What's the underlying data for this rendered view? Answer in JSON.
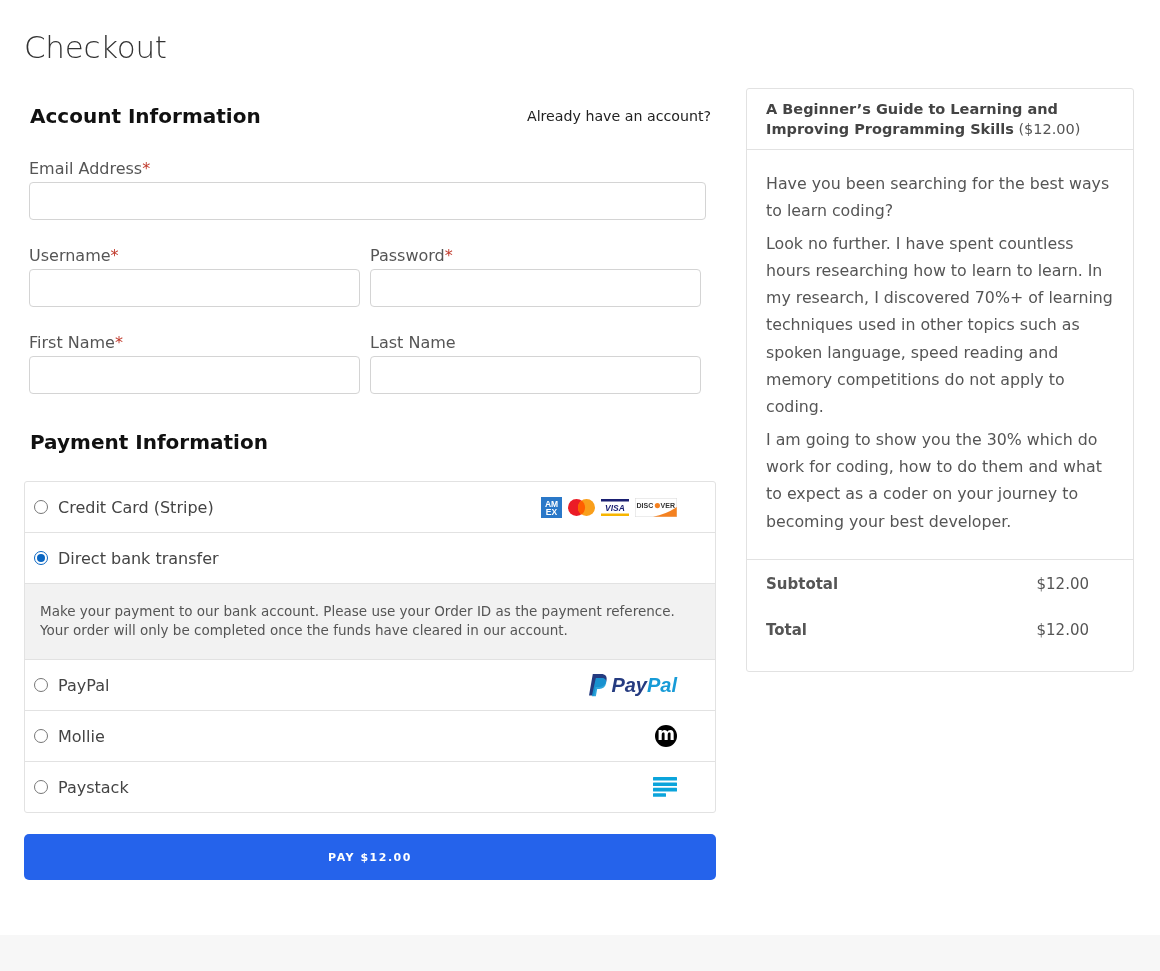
{
  "page": {
    "title": "Checkout"
  },
  "account": {
    "heading": "Account Information",
    "login_link": "Already have an account?",
    "required_mark": "*",
    "field_rows": [
      [
        {
          "label": "Email Address",
          "required": true
        }
      ],
      [
        {
          "label": "Username",
          "required": true
        },
        {
          "label": "Password",
          "required": true
        }
      ],
      [
        {
          "label": "First Name",
          "required": true
        },
        {
          "label": "Last Name",
          "required": false
        }
      ]
    ]
  },
  "payment": {
    "heading": "Payment Information",
    "methods": [
      {
        "label": "Credit Card (Stripe)",
        "selected": false,
        "logo": {
          "kind": "cards",
          "cards": [
            {
              "kind": "amex",
              "lines": [
                "AM",
                "EX"
              ]
            },
            {
              "kind": "mastercard"
            },
            {
              "kind": "visa",
              "text": "VISA"
            },
            {
              "kind": "discover",
              "parts": [
                "DISC",
                "VER"
              ]
            }
          ]
        }
      },
      {
        "label": "Direct bank transfer",
        "selected": true,
        "description": "Make your payment to our bank account. Please use your Order ID as the payment reference. Your order will only be completed once the funds have cleared in our account."
      },
      {
        "label": "PayPal",
        "selected": false,
        "logo": {
          "kind": "paypal",
          "parts": [
            "Pay",
            "Pal"
          ]
        }
      },
      {
        "label": "Mollie",
        "selected": false,
        "logo": {
          "kind": "mollie",
          "mark": "m"
        }
      },
      {
        "label": "Paystack",
        "selected": false,
        "logo": {
          "kind": "paystack"
        }
      }
    ]
  },
  "pay_button": "PAY $12.00",
  "summary": {
    "product_title": "**A Beginner’s Guide to Learning and Improving Programming Skills** ($12.00)",
    "paragraphs": [
      "Have you been searching for the best ways to learn coding?",
      "Look no further. I have spent countless hours researching how to learn to learn. In my research, I discovered 70%+ of learning techniques used in other topics such as spoken language, speed reading and memory competitions do not apply to coding.",
      "I am going to show you the 30% which do work for coding, how to do them and what to expect as a coder on your journey to becoming your best developer."
    ],
    "totals": [
      {
        "label": "Subtotal",
        "value": "$12.00"
      },
      {
        "label": "Total",
        "value": "$12.00"
      }
    ]
  }
}
